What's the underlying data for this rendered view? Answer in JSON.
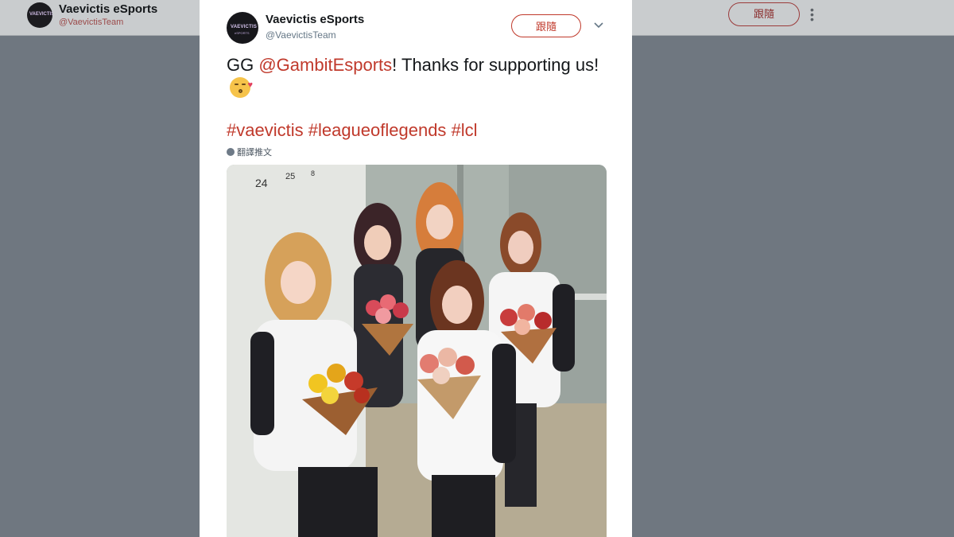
{
  "topbar": {
    "name": "Vaevictis eSports",
    "handle": "@VaevictisTeam",
    "follow_label": "跟隨",
    "more_icon": "vertical-dots-icon"
  },
  "tweet": {
    "author_name": "Vaevictis eSports",
    "author_handle": "@VaevictisTeam",
    "avatar_text": "VAEVICTIS",
    "avatar_subtext": "eSPORTS",
    "follow_label": "跟隨",
    "text_prefix": "GG ",
    "mention": "@GambitEsports",
    "text_suffix": "! Thanks for supporting us! ",
    "emoji": "kissing-face-with-heart",
    "hashtags": [
      "#vaevictis",
      "#leagueoflegends",
      "#lcl"
    ],
    "translate_label": "翻譯推文",
    "photo": "five-players-holding-bouquets"
  },
  "colors": {
    "accent": "#c0392b",
    "overlay": "#6f7780",
    "card": "#ffffff"
  }
}
